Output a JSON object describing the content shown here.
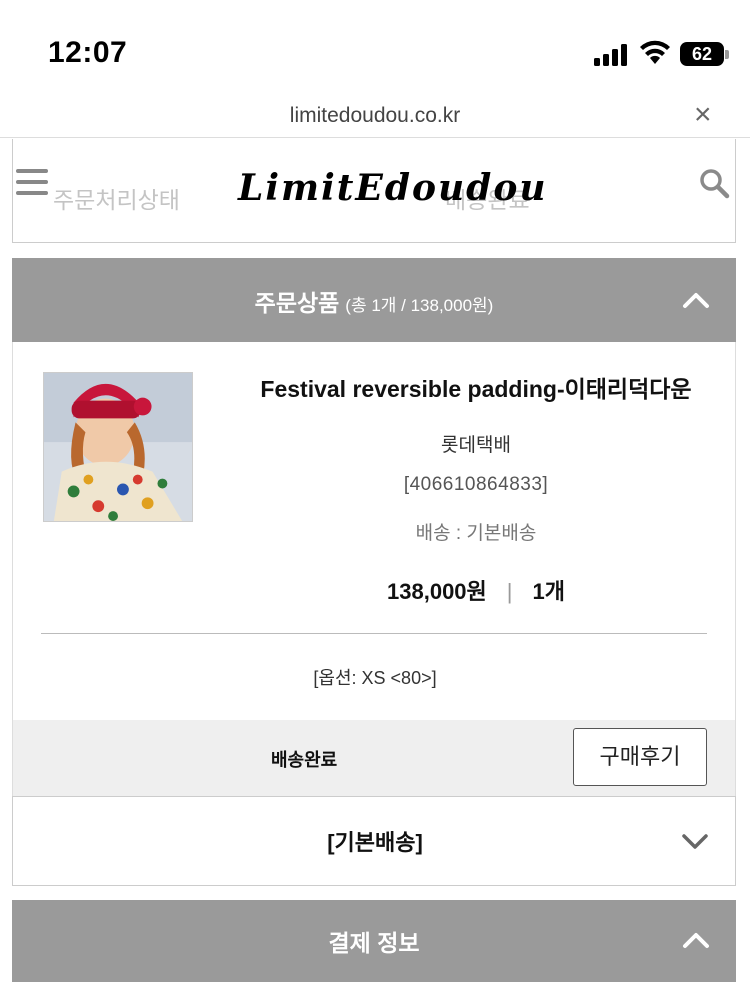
{
  "status_bar": {
    "time": "12:07",
    "battery": "62"
  },
  "browser": {
    "url": "limitedoudou.co.kr",
    "close_label": "×"
  },
  "header": {
    "logo": "LimitEdoudou",
    "faded_left": "주문처리상태",
    "faded_right": "배송완료"
  },
  "order_section": {
    "title": "주문상품",
    "summary": "(총 1개 / 138,000원)"
  },
  "product": {
    "name": "Festival reversible padding-이태리덕다운",
    "courier": "롯데택배",
    "tracking": "[406610864833]",
    "shipping_type": "배송 : 기본배송",
    "price": "138,000원",
    "divider": "|",
    "quantity": "1개",
    "option": "[옵션: XS <80>]"
  },
  "status_row": {
    "status": "배송완료",
    "review_button": "구매후기"
  },
  "basic_shipping": {
    "label": "[기본배송]"
  },
  "payment_section": {
    "title": "결제 정보"
  },
  "icons": {
    "menu": "hamburger-icon",
    "search": "search-icon",
    "collapse": "chevron-up-icon",
    "expand": "chevron-down-icon"
  },
  "colors": {
    "section_header_bg": "#9a9a9a",
    "status_row_bg": "#efefef"
  }
}
